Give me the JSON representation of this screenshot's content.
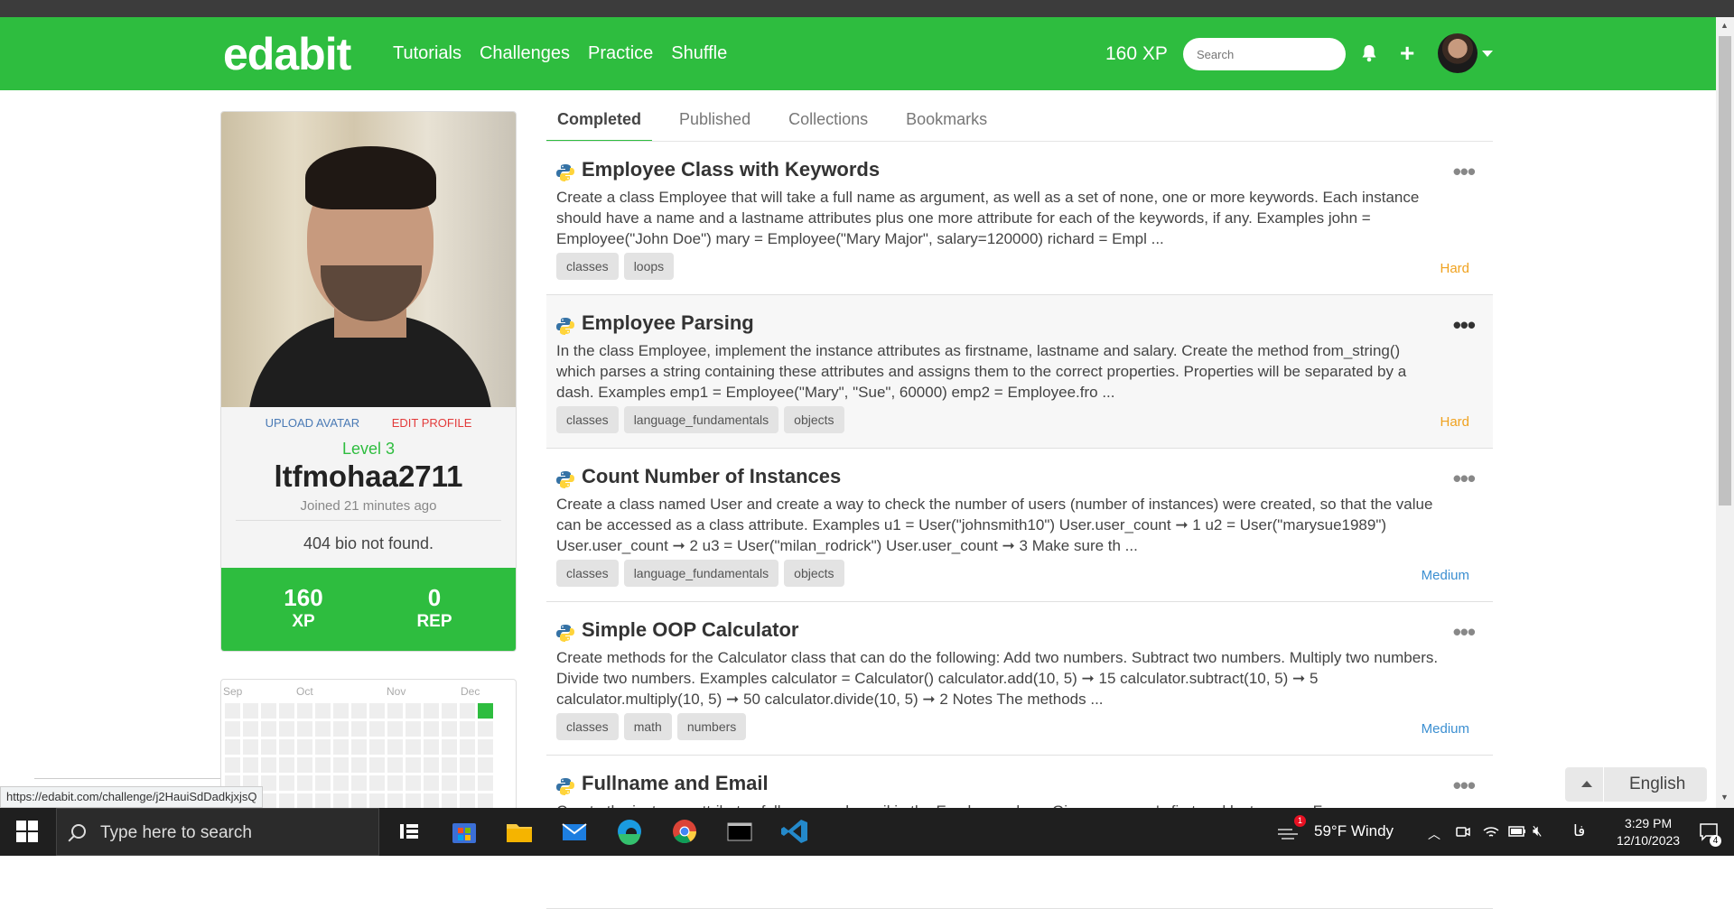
{
  "navbar": {
    "logo": "edabit",
    "links": [
      "Tutorials",
      "Challenges",
      "Practice",
      "Shuffle"
    ],
    "xp": "160 XP",
    "search_placeholder": "Search"
  },
  "profile": {
    "upload_avatar": "UPLOAD AVATAR",
    "edit_profile": "EDIT PROFILE",
    "level": "Level 3",
    "username": "ltfmohaa2711",
    "joined": "Joined 21 minutes ago",
    "bio": "404 bio not found.",
    "xp_value": "160",
    "xp_label": "XP",
    "rep_value": "0",
    "rep_label": "REP"
  },
  "heatmap": {
    "months": [
      "Sep",
      "Oct",
      "Nov",
      "Dec"
    ]
  },
  "tabs": [
    "Completed",
    "Published",
    "Collections",
    "Bookmarks"
  ],
  "challenges": [
    {
      "title": "Employee Class with Keywords",
      "description": "Create a class Employee that will take a full name as argument, as well as a set of none, one or more keywords. Each instance should have a name and a lastname attributes plus one more attribute for each of the keywords, if any. Examples john = Employee(\"John Doe\") mary = Employee(\"Mary Major\", salary=120000) richard = Empl ...",
      "tags": [
        "classes",
        "loops"
      ],
      "difficulty": "Hard"
    },
    {
      "title": "Employee Parsing",
      "description": "In the class Employee, implement the instance attributes as firstname, lastname and salary. Create the method from_string() which parses a string containing these attributes and assigns them to the correct properties. Properties will be separated by a dash. Examples emp1 = Employee(\"Mary\", \"Sue\", 60000) emp2 = Employee.fro ...",
      "tags": [
        "classes",
        "language_fundamentals",
        "objects"
      ],
      "difficulty": "Hard"
    },
    {
      "title": "Count Number of Instances",
      "description": "Create a class named User and create a way to check the number of users (number of instances) were created, so that the value can be accessed as a class attribute. Examples u1 = User(\"johnsmith10\") User.user_count ➞ 1 u2 = User(\"marysue1989\") User.user_count ➞ 2 u3 = User(\"milan_rodrick\") User.user_count ➞ 3 Make sure th ...",
      "tags": [
        "classes",
        "language_fundamentals",
        "objects"
      ],
      "difficulty": "Medium"
    },
    {
      "title": "Simple OOP Calculator",
      "description": "Create methods for the Calculator class that can do the following: Add two numbers. Subtract two numbers. Multiply two numbers. Divide two numbers. Examples calculator = Calculator() calculator.add(10, 5) ➞ 15 calculator.subtract(10, 5) ➞ 5 calculator.multiply(10, 5) ➞ 50 calculator.divide(10, 5) ➞ 2 Notes The methods ...",
      "tags": [
        "classes",
        "math",
        "numbers"
      ],
      "difficulty": "Medium"
    },
    {
      "title": "Fullname and Email",
      "description": "Create the instance attributes fullname and email in the Employee class. Given a person's first and last names: Form ...",
      "tags": [],
      "difficulty": ""
    }
  ],
  "status_url": "https://edabit.com/challenge/j2HauiSdDadkjxjsQ",
  "language_button": "English",
  "taskbar": {
    "search_text": "Type here to search",
    "weather": "59°F  Windy",
    "time": "3:29 PM",
    "date": "12/10/2023",
    "notification_count": "4",
    "weather_badge": "1",
    "lang_indicator": "فا"
  },
  "colors": {
    "brand_green": "#2ebd3f",
    "hard": "#f0a21f",
    "medium": "#3b8fd1"
  }
}
